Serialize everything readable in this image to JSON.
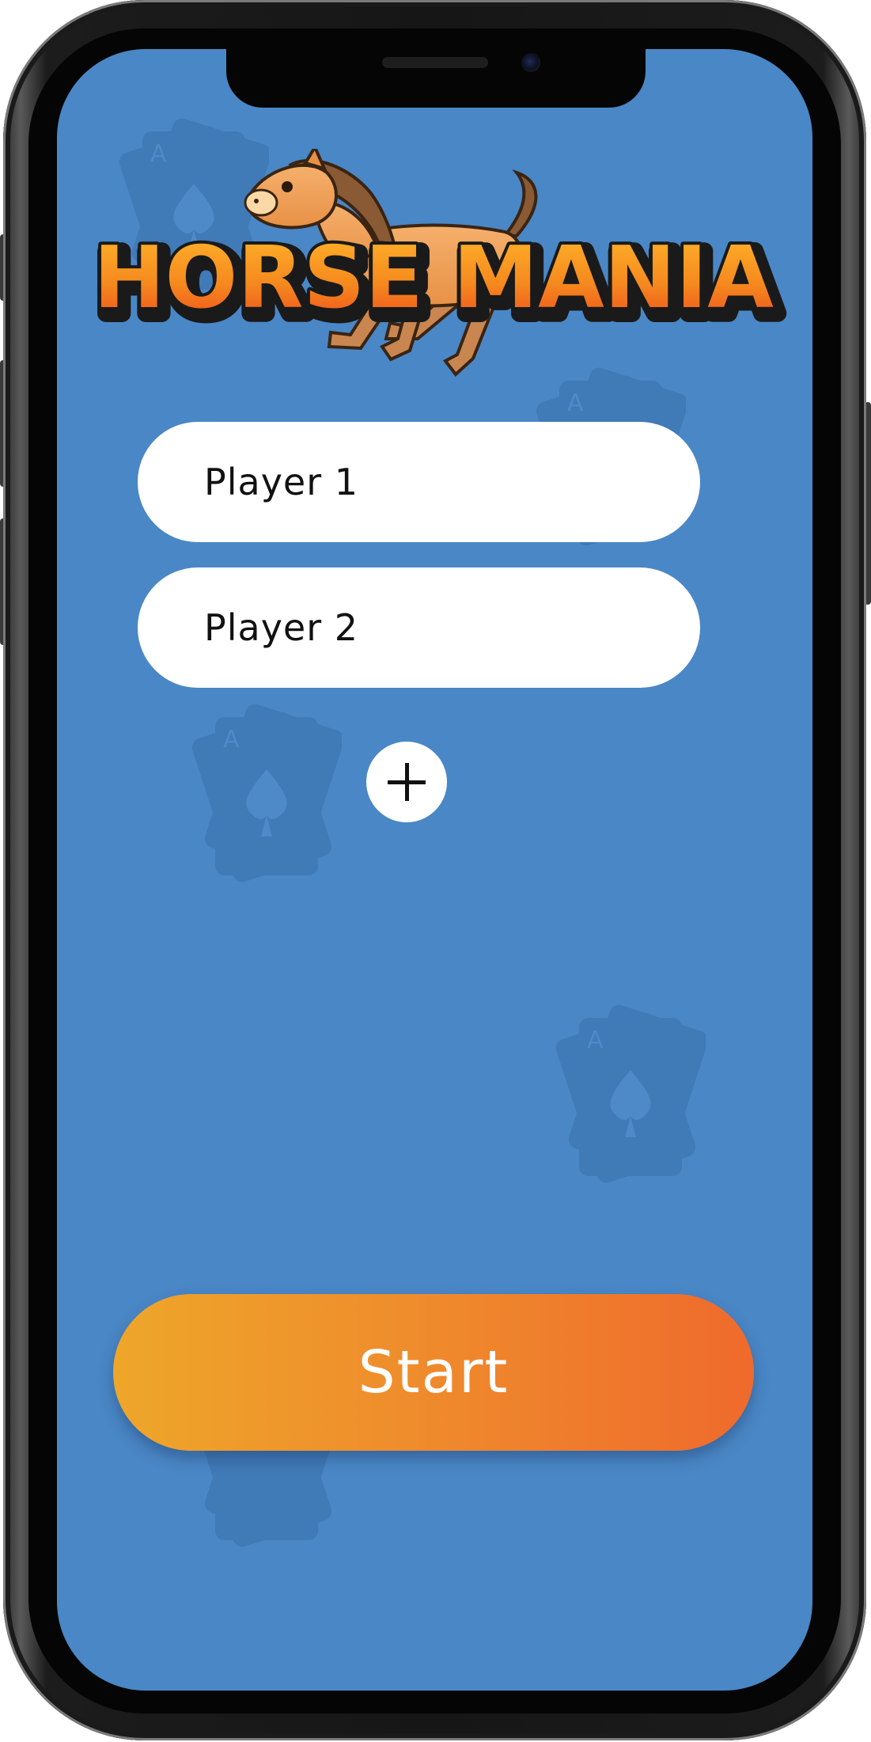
{
  "app": {
    "title": "HORSE MANIA"
  },
  "players": [
    {
      "placeholder": "Player 1"
    },
    {
      "placeholder": "Player 2"
    }
  ],
  "add_player": {
    "icon": "plus-icon"
  },
  "start_button": {
    "label": "Start"
  },
  "colors": {
    "background": "#4a87c6",
    "button_gradient_start": "#eea62a",
    "button_gradient_end": "#ef6a2c",
    "field_background": "#ffffff"
  }
}
